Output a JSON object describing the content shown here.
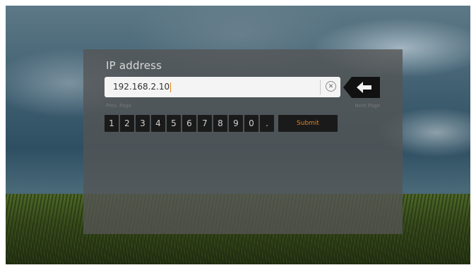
{
  "dialog": {
    "title": "IP address",
    "input_value": "192.168.2.10",
    "clear_icon": "clear-x-icon",
    "back_icon": "backspace-arrow-icon",
    "page_hints": [
      "Prev. Page",
      "Next Page"
    ]
  },
  "keypad": {
    "keys": [
      "1",
      "2",
      "3",
      "4",
      "5",
      "6",
      "7",
      "8",
      "9",
      "0",
      "."
    ],
    "submit_label": "Submit"
  },
  "colors": {
    "accent": "#e5811f",
    "panel": "#555555",
    "key_bg": "#1a1a1a"
  }
}
